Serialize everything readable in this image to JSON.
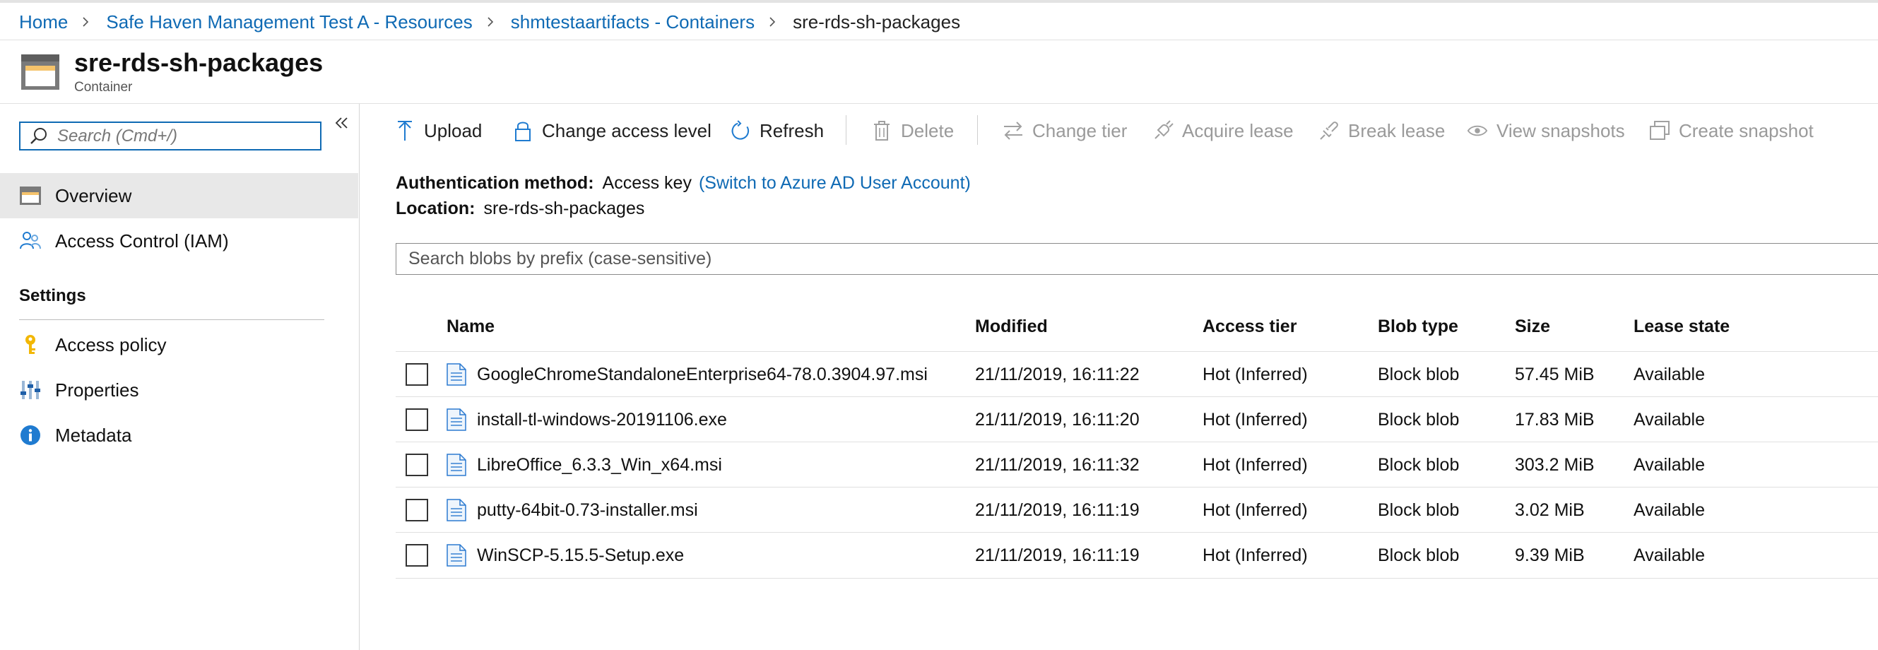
{
  "breadcrumb": {
    "items": [
      "Home",
      "Safe Haven Management Test A - Resources",
      "shmtestaartifacts - Containers"
    ],
    "current": "sre-rds-sh-packages"
  },
  "header": {
    "title": "sre-rds-sh-packages",
    "subtitle": "Container",
    "icon": "container-icon"
  },
  "sidebar": {
    "search_placeholder": "Search (Cmd+/)",
    "items": [
      {
        "label": "Overview",
        "icon": "container-icon",
        "active": true
      },
      {
        "label": "Access Control (IAM)",
        "icon": "people-icon"
      }
    ],
    "settings_title": "Settings",
    "settings_items": [
      {
        "label": "Access policy",
        "icon": "key-icon"
      },
      {
        "label": "Properties",
        "icon": "sliders-icon"
      },
      {
        "label": "Metadata",
        "icon": "info-icon"
      }
    ]
  },
  "toolbar": {
    "upload": "Upload",
    "change_access": "Change access level",
    "refresh": "Refresh",
    "delete": "Delete",
    "change_tier": "Change tier",
    "acquire_lease": "Acquire lease",
    "break_lease": "Break lease",
    "view_snapshots": "View snapshots",
    "create_snapshot": "Create snapshot"
  },
  "info": {
    "auth_label": "Authentication method:",
    "auth_value": "Access key",
    "auth_link": "(Switch to Azure AD User Account)",
    "location_label": "Location:",
    "location_value": "sre-rds-sh-packages"
  },
  "blob_search": {
    "placeholder": "Search blobs by prefix (case-sensitive)"
  },
  "table": {
    "columns": [
      "Name",
      "Modified",
      "Access tier",
      "Blob type",
      "Size",
      "Lease state"
    ],
    "rows": [
      {
        "name": "GoogleChromeStandaloneEnterprise64-78.0.3904.97.msi",
        "modified": "21/11/2019, 16:11:22",
        "tier": "Hot (Inferred)",
        "type": "Block blob",
        "size": "57.45 MiB",
        "lease": "Available"
      },
      {
        "name": "install-tl-windows-20191106.exe",
        "modified": "21/11/2019, 16:11:20",
        "tier": "Hot (Inferred)",
        "type": "Block blob",
        "size": "17.83 MiB",
        "lease": "Available"
      },
      {
        "name": "LibreOffice_6.3.3_Win_x64.msi",
        "modified": "21/11/2019, 16:11:32",
        "tier": "Hot (Inferred)",
        "type": "Block blob",
        "size": "303.2 MiB",
        "lease": "Available"
      },
      {
        "name": "putty-64bit-0.73-installer.msi",
        "modified": "21/11/2019, 16:11:19",
        "tier": "Hot (Inferred)",
        "type": "Block blob",
        "size": "3.02 MiB",
        "lease": "Available"
      },
      {
        "name": "WinSCP-5.15.5-Setup.exe",
        "modified": "21/11/2019, 16:11:19",
        "tier": "Hot (Inferred)",
        "type": "Block blob",
        "size": "9.39 MiB",
        "lease": "Available"
      }
    ]
  },
  "colors": {
    "accent": "#0f6ab4",
    "disabled": "#9a9a9a",
    "active_nav": "#e8e8e8"
  }
}
